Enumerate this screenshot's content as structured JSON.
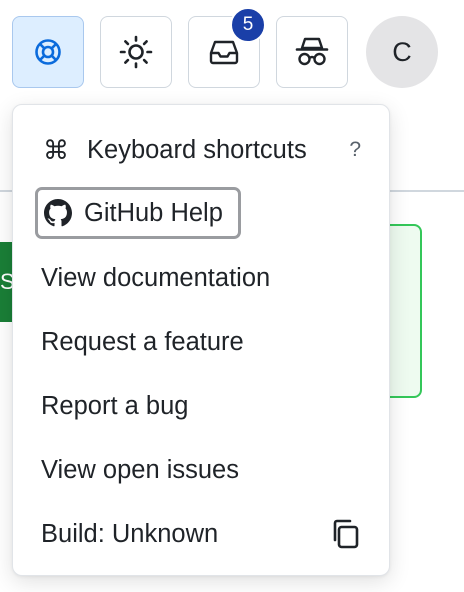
{
  "header": {
    "inbox_badge": "5",
    "avatar_initial": "C"
  },
  "background": {
    "button_partial_label": "S"
  },
  "help_menu": {
    "items": [
      {
        "label": "Keyboard shortcuts",
        "icon": "command-icon",
        "shortcut": "?"
      },
      {
        "label": "GitHub Help",
        "icon": "github-icon"
      },
      {
        "label": "View documentation"
      },
      {
        "label": "Request a feature"
      },
      {
        "label": "Report a bug"
      },
      {
        "label": "View open issues"
      },
      {
        "label": "Build: Unknown",
        "action_icon": "copy-icon"
      }
    ]
  },
  "colors": {
    "active_button_bg": "#ddeeff",
    "badge_bg": "#1a3fa8",
    "success_green": "#1a7f37",
    "card_border": "#34c759"
  }
}
